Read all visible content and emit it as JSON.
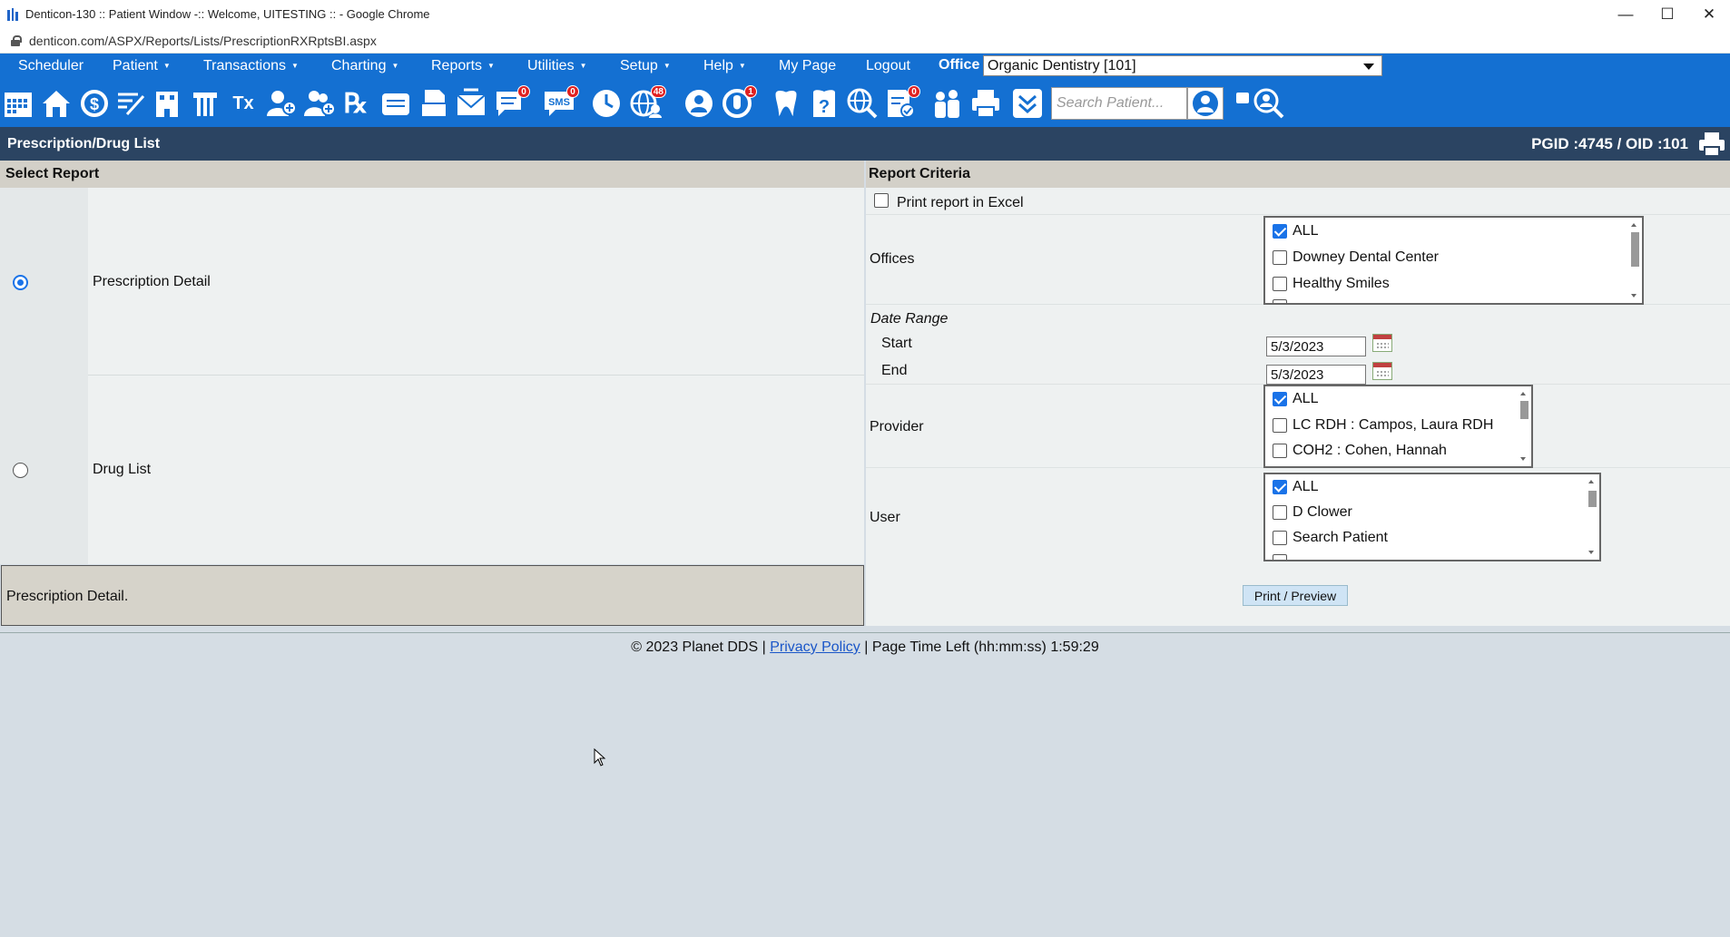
{
  "window": {
    "title": "Denticon-130 :: Patient Window -:: Welcome, UITESTING :: - Google Chrome",
    "url": "denticon.com/ASPX/Reports/Lists/PrescriptionRXRptsBI.aspx"
  },
  "menu": {
    "items": [
      {
        "label": "Scheduler",
        "caret": false
      },
      {
        "label": "Patient",
        "caret": true
      },
      {
        "label": "Transactions",
        "caret": true
      },
      {
        "label": "Charting",
        "caret": true
      },
      {
        "label": "Reports",
        "caret": true
      },
      {
        "label": "Utilities",
        "caret": true
      },
      {
        "label": "Setup",
        "caret": true
      },
      {
        "label": "Help",
        "caret": true
      },
      {
        "label": "My Page",
        "caret": false
      },
      {
        "label": "Logout",
        "caret": false
      }
    ],
    "office_label": "Office",
    "office_value": "Organic Dentistry [101]"
  },
  "toolbar": {
    "search_placeholder": "Search Patient...",
    "badges": {
      "messages": "0",
      "sms": "0",
      "web": "48",
      "alerts": "1",
      "forms": "0"
    }
  },
  "page": {
    "title": "Prescription/Drug List",
    "pgid": "PGID :4745  /  OID :101"
  },
  "select_report": {
    "header": "Select Report",
    "reports": [
      {
        "label": "Prescription Detail",
        "selected": true
      },
      {
        "label": "Drug List",
        "selected": false
      }
    ],
    "description": "Prescription Detail."
  },
  "criteria": {
    "header": "Report Criteria",
    "excel_label": "Print report in Excel",
    "offices_label": "Offices",
    "offices": [
      {
        "label": "ALL",
        "checked": true
      },
      {
        "label": "Downey Dental Center",
        "checked": false
      },
      {
        "label": "Healthy Smiles",
        "checked": false
      }
    ],
    "date_range_label": "Date Range",
    "start_label": "Start",
    "start_value": "5/3/2023",
    "end_label": "End",
    "end_value": "5/3/2023",
    "provider_label": "Provider",
    "providers": [
      {
        "label": "ALL",
        "checked": true
      },
      {
        "label": "LC RDH : Campos, Laura RDH",
        "checked": false
      },
      {
        "label": "COH2 : Cohen, Hannah",
        "checked": false
      }
    ],
    "user_label": "User",
    "users": [
      {
        "label": "ALL",
        "checked": true
      },
      {
        "label": "D Clower",
        "checked": false
      },
      {
        "label": "Search Patient",
        "checked": false
      }
    ],
    "print_button": "Print / Preview"
  },
  "footer": {
    "copyright": "© 2023 Planet DDS |",
    "privacy": "Privacy Policy",
    "time_left": "|  Page Time Left (hh:mm:ss) 1:59:29"
  },
  "colors": {
    "nav_blue": "#1470d2",
    "header_navy": "#2b4462",
    "section_tan": "#d3d0c8",
    "accent": "#1a73e8"
  }
}
